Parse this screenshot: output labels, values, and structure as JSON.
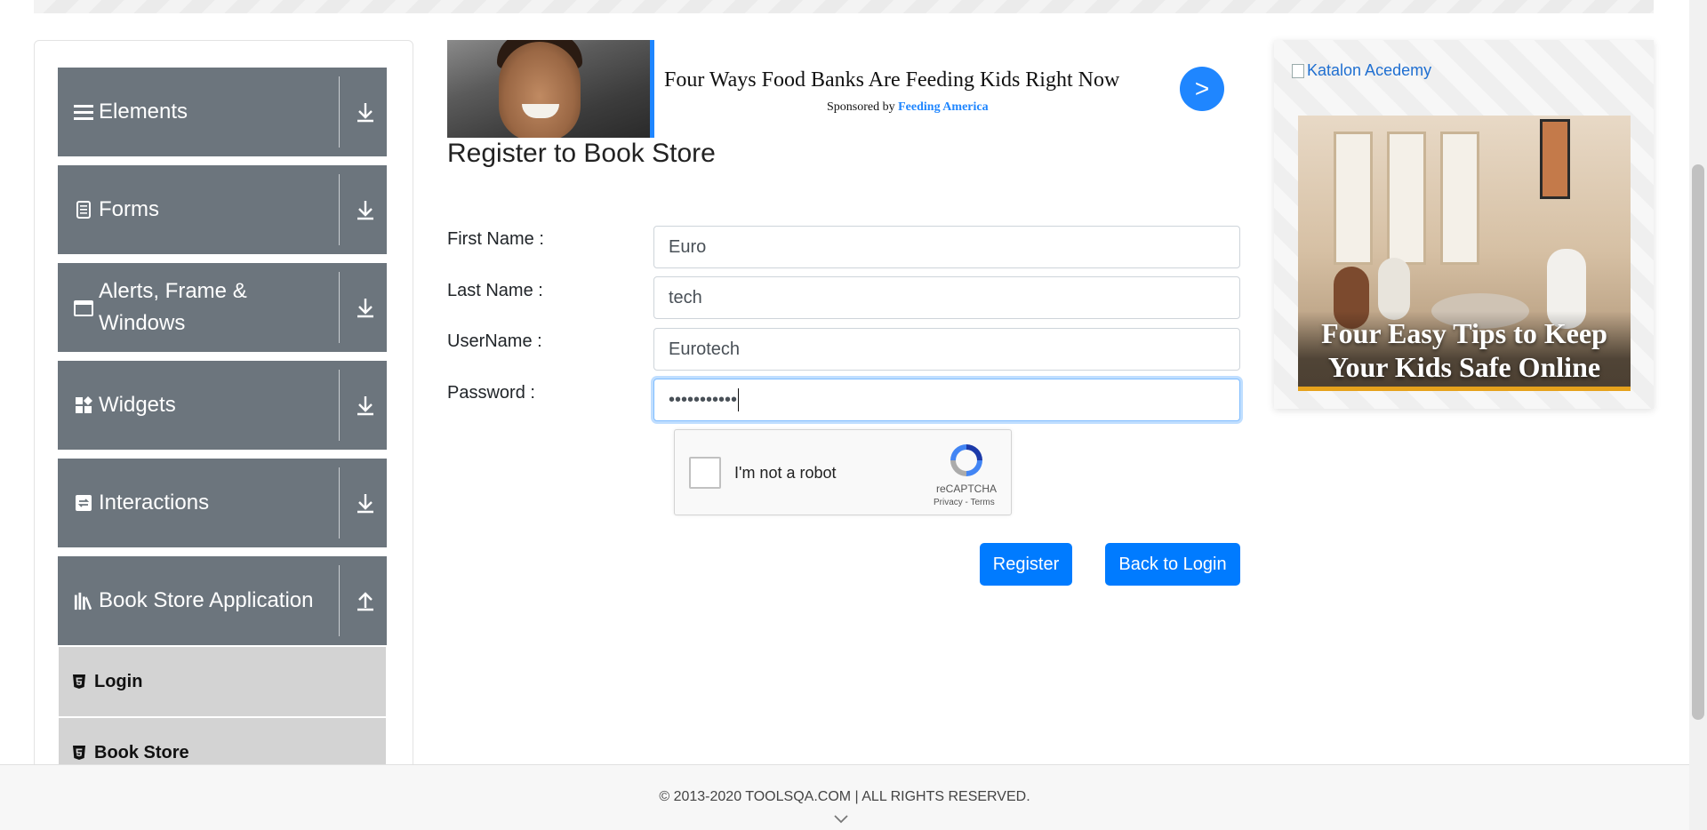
{
  "sidebar": {
    "groups": [
      {
        "label": "Elements",
        "icon": "menu-icon",
        "arrow": "down"
      },
      {
        "label": "Forms",
        "icon": "document-icon",
        "arrow": "down"
      },
      {
        "label": "Alerts, Frame & Windows",
        "icon": "window-icon",
        "arrow": "down"
      },
      {
        "label": "Widgets",
        "icon": "widgets-icon",
        "arrow": "down"
      },
      {
        "label": "Interactions",
        "icon": "interactions-icon",
        "arrow": "down"
      },
      {
        "label": "Book Store Application",
        "icon": "books-icon",
        "arrow": "up"
      }
    ],
    "subitems": [
      {
        "label": "Login",
        "icon": "html5-icon"
      },
      {
        "label": "Book Store",
        "icon": "html5-icon"
      }
    ],
    "colors": {
      "group_bg": "#6c757d",
      "subitem_bg": "#d3d3d3"
    }
  },
  "top_ad": {
    "headline": "Four Ways Food Banks Are Feeding Kids Right Now",
    "sponsor_prefix": "Sponsored by",
    "sponsor_name": "Feeding America",
    "go_label": ">",
    "accent": "#1f86ff"
  },
  "form": {
    "title": "Register to Book Store",
    "fields": [
      {
        "label": "First Name :",
        "value": "Euro"
      },
      {
        "label": "Last Name :",
        "value": "tech"
      },
      {
        "label": "UserName :",
        "value": "Eurotech"
      },
      {
        "label": "Password :",
        "value": "•••••••••••"
      }
    ],
    "captcha": {
      "label": "I'm not a robot",
      "brand": "reCAPTCHA",
      "terms": "Privacy - Terms"
    },
    "register_label": "Register",
    "back_label": "Back to Login",
    "button_color": "#007bff"
  },
  "right_ad": {
    "alt_link": "Katalon Acedemy",
    "caption": "Four Easy Tips to Keep Your Kids Safe Online"
  },
  "footer": {
    "text": "© 2013-2020 TOOLSQA.COM | ALL RIGHTS RESERVED."
  }
}
